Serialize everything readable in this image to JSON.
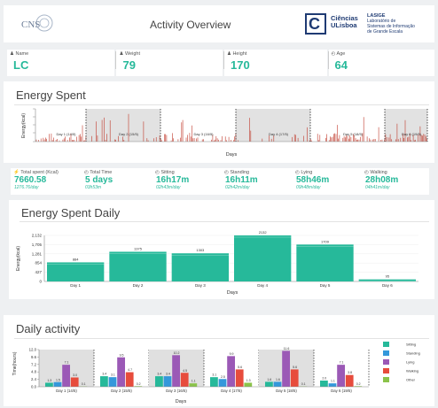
{
  "header": {
    "logo_left": "CNS",
    "title": "Activity Overview",
    "logo_right_letter": "C",
    "logo_right_org_line1": "Ciências",
    "logo_right_org_line2": "ULisboa",
    "lab_acronym": "LASIGE",
    "lab_line1": "Laboratório de",
    "lab_line2": "Sistemas de Informação",
    "lab_line3": "de Grande Escala"
  },
  "profile": [
    {
      "label": "Name",
      "icon": "user-icon",
      "value": "LC"
    },
    {
      "label": "Weight",
      "icon": "user-icon",
      "value": "79"
    },
    {
      "label": "Height",
      "icon": "user-icon",
      "value": "170"
    },
    {
      "label": "Age",
      "icon": "clock-icon",
      "value": "64"
    }
  ],
  "energy_spent": {
    "title": "Energy Spent",
    "ylabel": "Energy(kcal)",
    "xlabel": "Days",
    "day_labels": [
      "Day 1 (14/5)",
      "Day 2 (15/5)",
      "Day 3 (16/5)",
      "Day 4 (17/5)",
      "Day 5 (18/5)",
      "Day 6 (19/5)"
    ]
  },
  "summary": [
    {
      "label": "Total spent (Kcal)",
      "icon": "bolt-icon",
      "value": "7660.58",
      "sub": "1276.76/day"
    },
    {
      "label": "Total Time",
      "icon": "clock-icon",
      "value": "5 days",
      "sub": "03h53m"
    },
    {
      "label": "Sitting",
      "icon": "clock-icon",
      "value": "16h17m",
      "sub": "02h43m/day"
    },
    {
      "label": "Standing",
      "icon": "clock-icon",
      "value": "16h11m",
      "sub": "02h42m/day"
    },
    {
      "label": "Lying",
      "icon": "clock-icon",
      "value": "58h46m",
      "sub": "09h48m/day"
    },
    {
      "label": "Walking",
      "icon": "clock-icon",
      "value": "28h08m",
      "sub": "04h41m/day"
    }
  ],
  "chart_data": [
    {
      "type": "bar",
      "title": "Energy Spent Daily",
      "xlabel": "Days",
      "ylabel": "Energy(kcal)",
      "categories": [
        "Day 1",
        "Day 2",
        "Day 3",
        "Day 4",
        "Day 5",
        "Day 6"
      ],
      "values": [
        884,
        1375,
        1303,
        2132,
        1709,
        95
      ],
      "value_labels": [
        "884",
        "1375",
        "1303",
        "2132",
        "1709",
        "95"
      ],
      "yticks": [
        "2,132",
        "1,705",
        "1,281",
        "854",
        "427",
        "0"
      ],
      "ylim": [
        0,
        2132
      ],
      "color": "#26b99a"
    },
    {
      "type": "bar",
      "title": "Daily activity",
      "xlabel": "Days",
      "ylabel": "Time(hours)",
      "categories": [
        "Day 1 (14/5)",
        "Day 2 (15/5)",
        "Day 3 (16/5)",
        "Day 4 (17/5)",
        "Day 5 (18/5)",
        "Day 6 (19/5)"
      ],
      "yticks": [
        "12.0",
        "9.6",
        "7.2",
        "4.8",
        "2.4",
        "0.0"
      ],
      "ylim": [
        0,
        12
      ],
      "series": [
        {
          "name": "Sitting",
          "color": "#26b99a",
          "values": [
            1.3,
            3.4,
            3.4,
            3.1,
            1.6,
            2.0
          ]
        },
        {
          "name": "Standing",
          "color": "#3498db",
          "values": [
            1.5,
            3.1,
            3.4,
            2.5,
            1.6,
            1.1
          ]
        },
        {
          "name": "Lying",
          "color": "#9b59b6",
          "values": [
            7.1,
            9.5,
            10.2,
            9.9,
            11.6,
            7.1
          ]
        },
        {
          "name": "Walking",
          "color": "#e74c3c",
          "values": [
            3.0,
            4.7,
            4.5,
            5.6,
            5.6,
            3.8
          ]
        },
        {
          "name": "Other",
          "color": "#8bc34a",
          "values": [
            0.1,
            0.2,
            1.1,
            1.3,
            0.1,
            0.2
          ]
        }
      ]
    }
  ],
  "colors": {
    "accent": "#26b99a",
    "red_series": "#c0392b",
    "brand": "#1f3b73"
  }
}
